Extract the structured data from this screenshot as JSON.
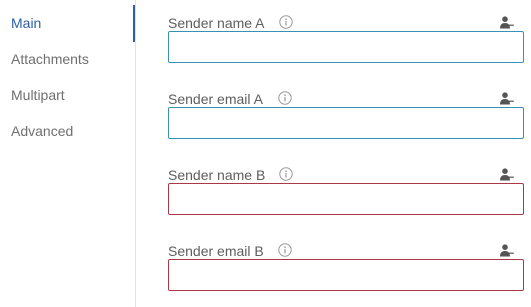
{
  "nav": {
    "items": [
      {
        "label": "Main",
        "active": true
      },
      {
        "label": "Attachments",
        "active": false
      },
      {
        "label": "Multipart",
        "active": false
      },
      {
        "label": "Advanced",
        "active": false
      }
    ]
  },
  "fields": [
    {
      "label": "Sender name A",
      "value": "",
      "state": "normal",
      "info_icon": "info-circle-icon",
      "action_icon": "person-add-icon"
    },
    {
      "label": "Sender email A",
      "value": "",
      "state": "normal",
      "info_icon": "info-circle-icon",
      "action_icon": "person-add-icon"
    },
    {
      "label": "Sender name B",
      "value": "",
      "state": "error",
      "info_icon": "info-circle-icon",
      "action_icon": "person-add-icon"
    },
    {
      "label": "Sender email B",
      "value": "",
      "state": "error",
      "info_icon": "info-circle-icon",
      "action_icon": "person-add-icon"
    }
  ],
  "colors": {
    "accent": "#2d5fa8",
    "input_border": "#3a8fb5",
    "error_border": "#a83a48",
    "label_text": "#5e5e5e",
    "nav_text": "#6f6f6f"
  }
}
